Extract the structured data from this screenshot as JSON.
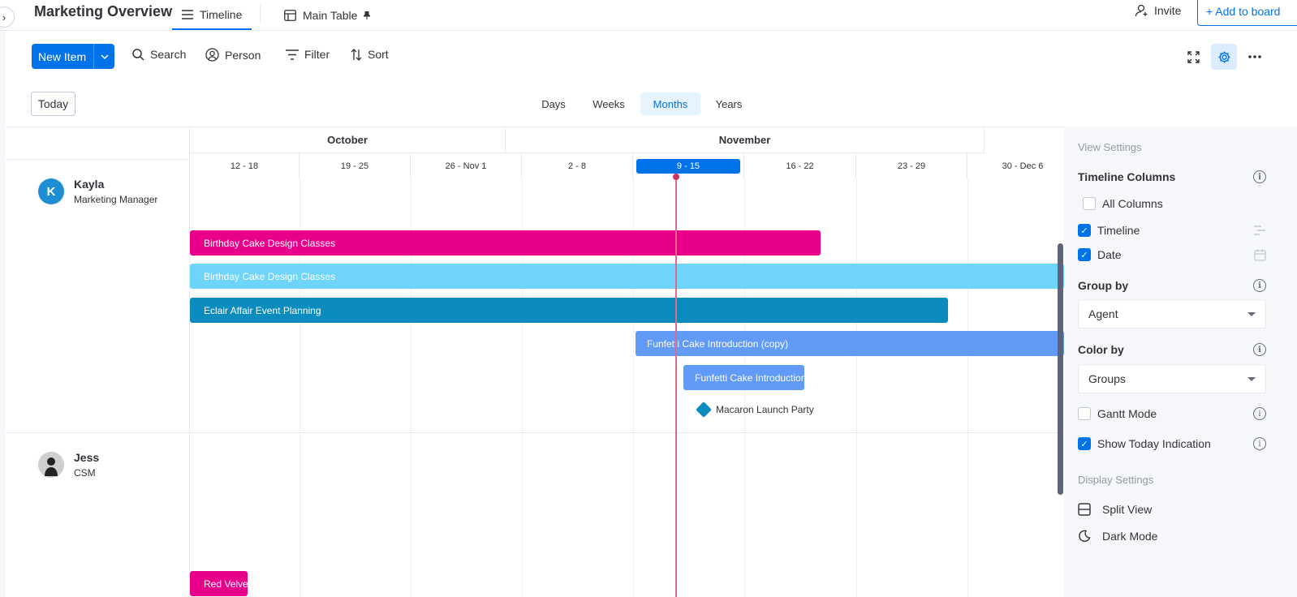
{
  "header": {
    "board_title": "Marketing Overview",
    "tabs": [
      {
        "label": "Timeline",
        "active": true
      },
      {
        "label": "Main Table"
      }
    ],
    "invite_label": "Invite",
    "add_board_label": "+ Add to board"
  },
  "toolbar": {
    "new_item_label": "New Item",
    "search_label": "Search",
    "person_label": "Person",
    "filter_label": "Filter",
    "sort_label": "Sort",
    "today_label": "Today",
    "scales": [
      "Days",
      "Weeks",
      "Months",
      "Years"
    ],
    "active_scale": "Months"
  },
  "timeline": {
    "months": [
      "October",
      "November"
    ],
    "weeks": [
      "12 - 18",
      "19 - 25",
      "26 - Nov 1",
      "2 - 8",
      "9 - 15",
      "16 - 22",
      "23 - 29",
      "30 - Dec 6"
    ],
    "current_week": "9 - 15",
    "groups": [
      {
        "name": "Kayla",
        "role": "Marketing Manager",
        "avatar_initial": "K",
        "avatar_color": "#1e8fd5"
      },
      {
        "name": "Jess",
        "role": "CSM",
        "avatar_initial": "",
        "avatar_color": "#555555"
      }
    ],
    "bars": [
      {
        "label": "Birthday Cake Design Classes",
        "color": "#e8008a"
      },
      {
        "label": "Birthday Cake Design Classes",
        "color": "#6fd4fa"
      },
      {
        "label": "Eclair Affair Event Planning",
        "color": "#0a8cbe"
      },
      {
        "label": "Funfetti Cake Introduction (copy)",
        "color": "#619bf7"
      },
      {
        "label": "Funfetti Cake Introduction",
        "color": "#619bf7"
      },
      {
        "label": "Red Velvet",
        "color": "#e8008a"
      }
    ],
    "milestone": {
      "label": "Macaron Launch Party",
      "color": "#0a8cbe"
    }
  },
  "settings": {
    "view_settings_title": "View Settings",
    "timeline_columns_title": "Timeline Columns",
    "all_columns_label": "All Columns",
    "timeline_label": "Timeline",
    "date_label": "Date",
    "group_by_title": "Group by",
    "group_by_value": "Agent",
    "color_by_title": "Color by",
    "color_by_value": "Groups",
    "gantt_mode_label": "Gantt Mode",
    "show_today_label": "Show Today Indication",
    "display_settings_title": "Display Settings",
    "split_view_label": "Split View",
    "dark_mode_label": "Dark Mode"
  }
}
